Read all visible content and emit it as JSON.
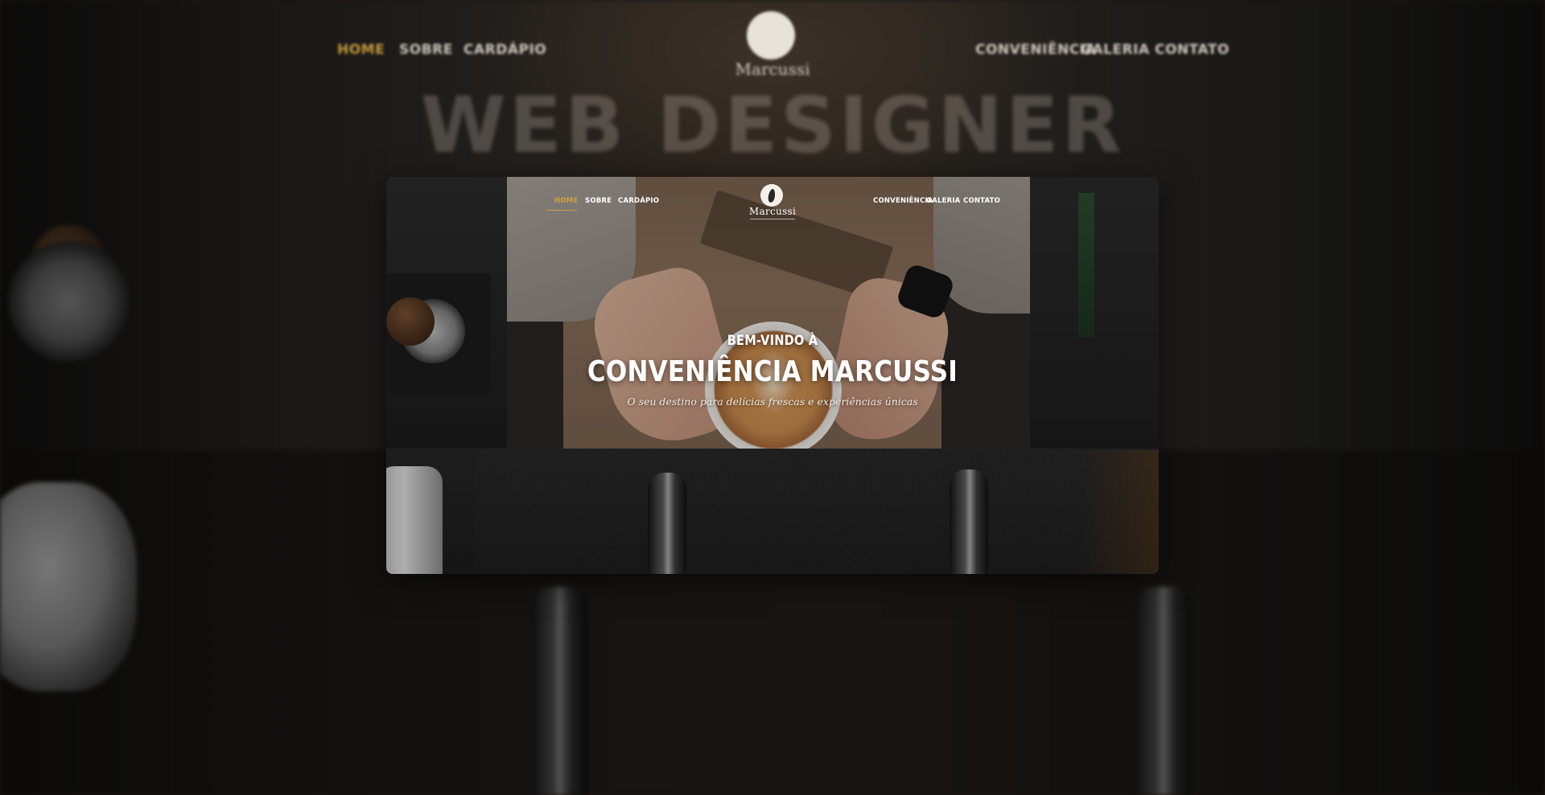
{
  "background_page": {
    "nav_left": [
      "HOME",
      "SOBRE",
      "CARDÁPIO"
    ],
    "nav_right": [
      "CONVENIÊNCIA",
      "GALERIA",
      "CONTATO"
    ],
    "logo_text": "Marcussi",
    "heading": "WEB DESIGNER"
  },
  "preview": {
    "nav": {
      "left": [
        {
          "label": "HOME",
          "active": true
        },
        {
          "label": "SOBRE",
          "active": false
        },
        {
          "label": "CARDÁPIO",
          "active": false
        }
      ],
      "right": [
        {
          "label": "CONVENIÊNCIA",
          "active": false
        },
        {
          "label": "GALERIA",
          "active": false
        },
        {
          "label": "CONTATO",
          "active": false
        }
      ]
    },
    "logo": {
      "text": "Marcussi",
      "icon": "coffee-bean-icon"
    },
    "hero": {
      "kicker": "BEM-VINDO À",
      "title": "CONVENIÊNCIA MARCUSSI",
      "subtitle": "O seu destino para delícias frescas e experiências únicas"
    }
  },
  "colors": {
    "accent": "#d4a140",
    "text": "#ffffff",
    "backdrop": "#1a1614"
  }
}
